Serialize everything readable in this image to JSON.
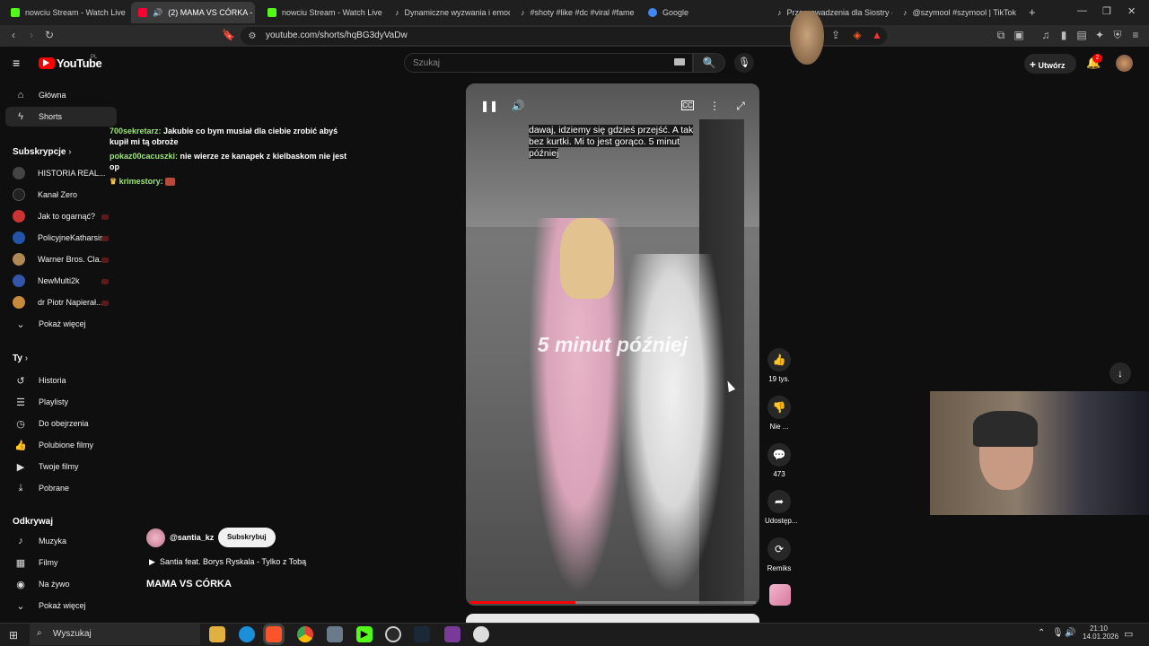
{
  "browser": {
    "tabs": [
      {
        "label": "nowciu Stream - Watch Live on",
        "color": "#53fc18"
      },
      {
        "label": "(2) MAMA VS CÓRKA -",
        "color": "#ff0033"
      },
      {
        "label": "nowciu Stream - Watch Live on",
        "color": "#53fc18"
      },
      {
        "label": "Dynamiczne wyzwania i emocj",
        "color": "#ffffff"
      },
      {
        "label": "#shoty #like #dc #viral #fame",
        "color": "#ffffff"
      },
      {
        "label": "Google",
        "color": "#4285f4"
      },
      {
        "label": "Przeprowadzenia dla Siostry – Me",
        "color": "#ffffff"
      },
      {
        "label": "@szymool #szymool | TikTok",
        "color": "#ffffff"
      }
    ],
    "new_tab": "+",
    "url": "youtube.com/shorts/hqBG3dyVaDw"
  },
  "yt": {
    "logo": "YouTube",
    "region": "PL",
    "search_placeholder": "Szukaj",
    "create_label": "Utwórz",
    "notif_count": "2"
  },
  "sidebar": {
    "home": "Główna",
    "shorts": "Shorts",
    "subs_title": "Subskrypcje",
    "subs": [
      {
        "label": "HISTORIA REAL...",
        "color": "#444"
      },
      {
        "label": "Kanał Zero",
        "color": "#222"
      },
      {
        "label": "Jak to ogarnąć?",
        "color": "#c33"
      },
      {
        "label": "PolicyjneKatharsis",
        "color": "#2255aa"
      },
      {
        "label": "Warner Bros. Cla...",
        "color": "#b08a55"
      },
      {
        "label": "NewMulti2k",
        "color": "#3355aa"
      },
      {
        "label": "dr Piotr Napierał...",
        "color": "#c78a3a"
      }
    ],
    "show_more": "Pokaż więcej",
    "you_title": "Ty",
    "you": [
      "Historia",
      "Playlisty",
      "Do obejrzenia",
      "Polubione filmy",
      "Twoje filmy",
      "Pobrane"
    ],
    "explore_title": "Odkrywaj",
    "explore": [
      "Muzyka",
      "Filmy",
      "Na żywo"
    ],
    "show_more2": "Pokaż więcej"
  },
  "chat": [
    {
      "name": "700sekretarz:",
      "text": " Jakubie co bym musiał dla ciebie zrobić abyś kupił mi tą obroże"
    },
    {
      "name": "pokaz00cacuszki:",
      "text": " nie wierze ze kanapek z kielbaskom nie jest op"
    },
    {
      "name": "krimestory:",
      "text": ""
    }
  ],
  "short": {
    "caption": "dawaj, idziemy się gdzieś przejść. A tak bez kurtki. Mi to jest gorąco. 5 minut później",
    "overlay": "5 minut później",
    "channel": "@santia_kz",
    "subscribe": "Subskrybuj",
    "music": "Santia feat. Borys Ryskala - Tylko z Tobą",
    "title": "MAMA VS CÓRKA",
    "progress": 0.37,
    "likes": "19 tys.",
    "dislike": "Nie ...",
    "comments": "473",
    "share": "Udostęp...",
    "remix": "Remiks"
  },
  "taskbar": {
    "search": "Wyszukaj",
    "time": "21:10",
    "date": "14.01.2026"
  }
}
